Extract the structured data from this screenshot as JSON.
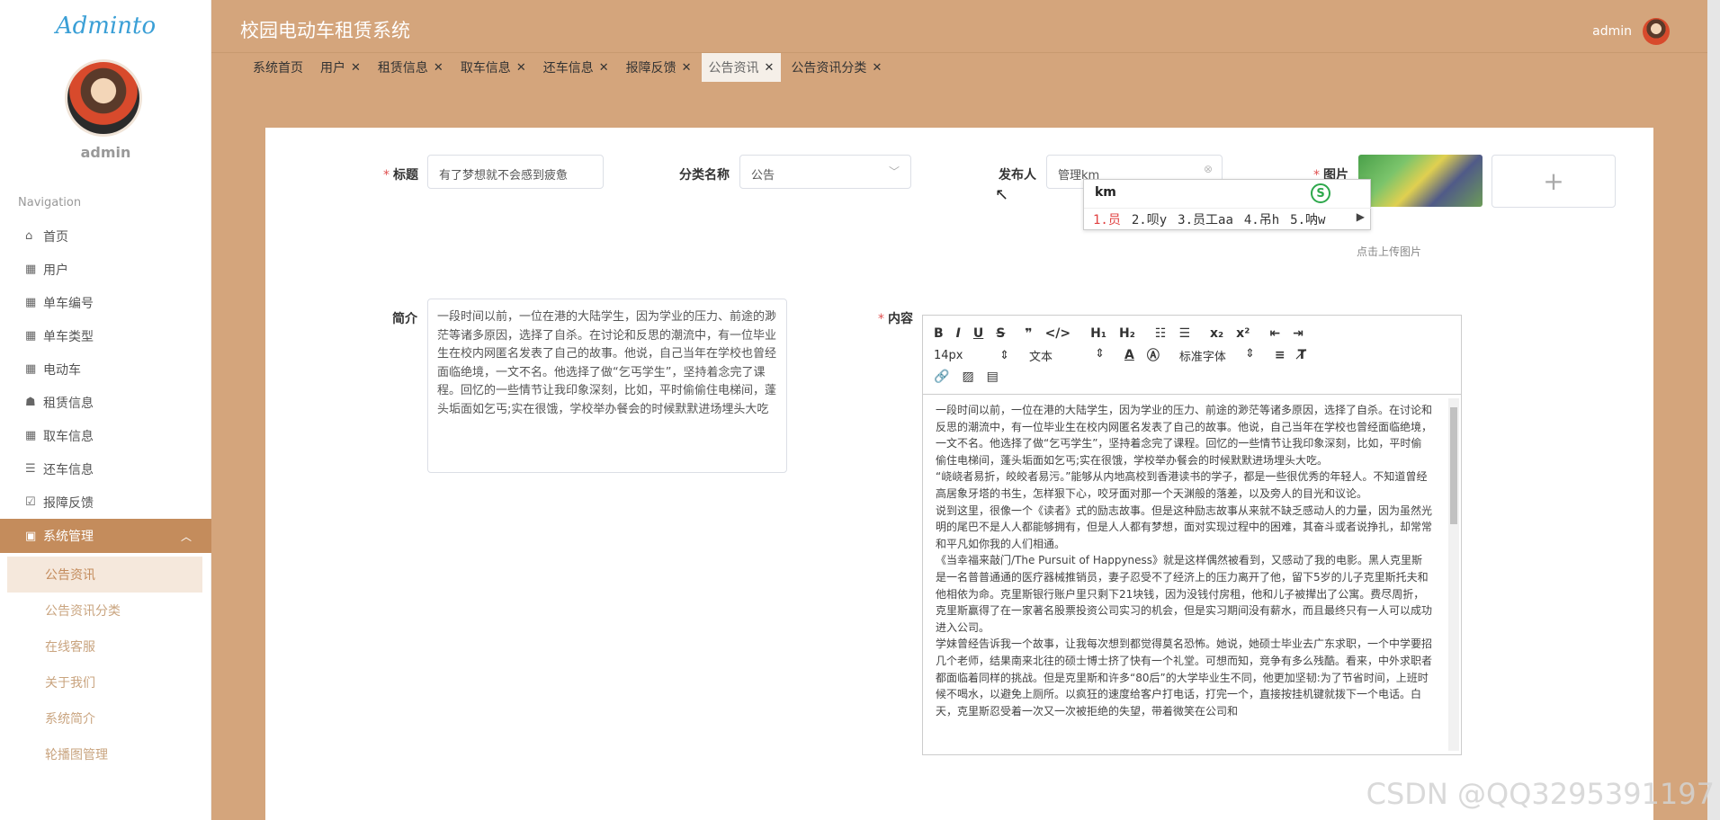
{
  "sidebar": {
    "logo": "Adminto",
    "username": "admin",
    "nav_title": "Navigation",
    "items": [
      {
        "icon": "home-icon",
        "glyph": "⌂",
        "label": "首页"
      },
      {
        "icon": "grid-icon",
        "glyph": "▦",
        "label": "用户"
      },
      {
        "icon": "grid-icon",
        "glyph": "▦",
        "label": "单车编号"
      },
      {
        "icon": "grid-icon",
        "glyph": "▦",
        "label": "单车类型"
      },
      {
        "icon": "grid-icon",
        "glyph": "▦",
        "label": "电动车"
      },
      {
        "icon": "thumb-icon",
        "glyph": "☗",
        "label": "租赁信息"
      },
      {
        "icon": "grid-icon",
        "glyph": "▦",
        "label": "取车信息"
      },
      {
        "icon": "list-icon",
        "glyph": "☰",
        "label": "还车信息"
      },
      {
        "icon": "check-icon",
        "glyph": "☑",
        "label": "报障反馈"
      },
      {
        "icon": "clipboard-icon",
        "glyph": "▣",
        "label": "系统管理"
      }
    ],
    "subitems": [
      "公告资讯",
      "公告资讯分类",
      "在线客服",
      "关于我们",
      "系统简介",
      "轮播图管理"
    ]
  },
  "header": {
    "title": "校园电动车租赁系统",
    "user": "admin"
  },
  "tabs": [
    "系统首页",
    "用户",
    "租赁信息",
    "取车信息",
    "还车信息",
    "报障反馈",
    "公告资讯",
    "公告资讯分类"
  ],
  "form": {
    "title_label": "标题",
    "title_value": "有了梦想就不会感到疲惫",
    "category_label": "分类名称",
    "category_value": "公告",
    "publisher_label": "发布人",
    "publisher_value": "管理km",
    "image_label": "图片",
    "upload_hint": "点击上传图片",
    "upload_plus": "+",
    "summary_label": "简介",
    "summary_value": "一段时间以前，一位在港的大陆学生，因为学业的压力、前途的渺茫等诸多原因，选择了自杀。在讨论和反思的潮流中，有一位毕业生在校内网匿名发表了自己的故事。他说，自己当年在学校也曾经面临绝境，一文不名。他选择了做“乞丐学生”，坚持着念完了课程。回忆的一些情节让我印象深刻，比如，平时偷偷住电梯间，蓬头垢面如乞丐;实在很饿，学校举办餐会的时候默默进场埋头大吃",
    "content_label": "内容"
  },
  "ime": {
    "input": "km",
    "candidates": [
      "1.员",
      "2.呗y",
      "3.员工aa",
      "4.吊h",
      "5.呐w"
    ]
  },
  "editor": {
    "font_size": "14px",
    "text_type": "文本",
    "font_family": "标准字体",
    "paragraphs": [
      "一段时间以前，一位在港的大陆学生，因为学业的压力、前途的渺茫等诸多原因，选择了自杀。在讨论和反思的潮流中，有一位毕业生在校内网匿名发表了自己的故事。他说，自己当年在学校也曾经面临绝境，一文不名。他选择了做“乞丐学生”，坚持着念完了课程。回忆的一些情节让我印象深刻，比如，平时偷偷住电梯间，蓬头垢面如乞丐;实在很饿，学校举办餐会的时候默默进场埋头大吃。",
      "“峣峣者易折，皎皎者易污。”能够从内地高校到香港读书的学子，都是一些很优秀的年轻人。不知道曾经高居象牙塔的书生，怎样狠下心，咬牙面对那一个天渊般的落差，以及旁人的目光和议论。",
      "说到这里，很像一个《读者》式的励志故事。但是这种励志故事从来就不缺乏感动人的力量，因为虽然光明的尾巴不是人人都能够拥有，但是人人都有梦想，面对实现过程中的困难，其奋斗或者说挣扎，却常常和平凡如你我的人们相通。",
      "《当幸福来敲门/The Pursuit of Happyness》就是这样偶然被看到，又感动了我的电影。黑人克里斯是一名普普通通的医疗器械推销员，妻子忍受不了经济上的压力离开了他，留下5岁的儿子克里斯托夫和他相依为命。克里斯银行账户里只剩下21块钱，因为没钱付房租，他和儿子被撵出了公寓。费尽周折，克里斯赢得了在一家著名股票投资公司实习的机会，但是实习期间没有薪水，而且最终只有一人可以成功进入公司。",
      "学妹曾经告诉我一个故事，让我每次想到都觉得莫名恐怖。她说，她硕士毕业去广东求职，一个中学要招几个老师，结果南来北往的硕士博士挤了快有一个礼堂。可想而知，竞争有多么残酷。看来，中外求职者都面临着同样的挑战。但是克里斯和许多“80后”的大学毕业生不同，他更加坚韧:为了节省时间，上班时候不喝水，以避免上厕所。以疯狂的速度给客户打电话，打完一个，直接按挂机键就拨下一个电话。白天，克里斯忍受着一次又一次被拒绝的失望，带着微笑在公司和"
    ]
  },
  "watermark": "CSDN @QQ3295391197"
}
